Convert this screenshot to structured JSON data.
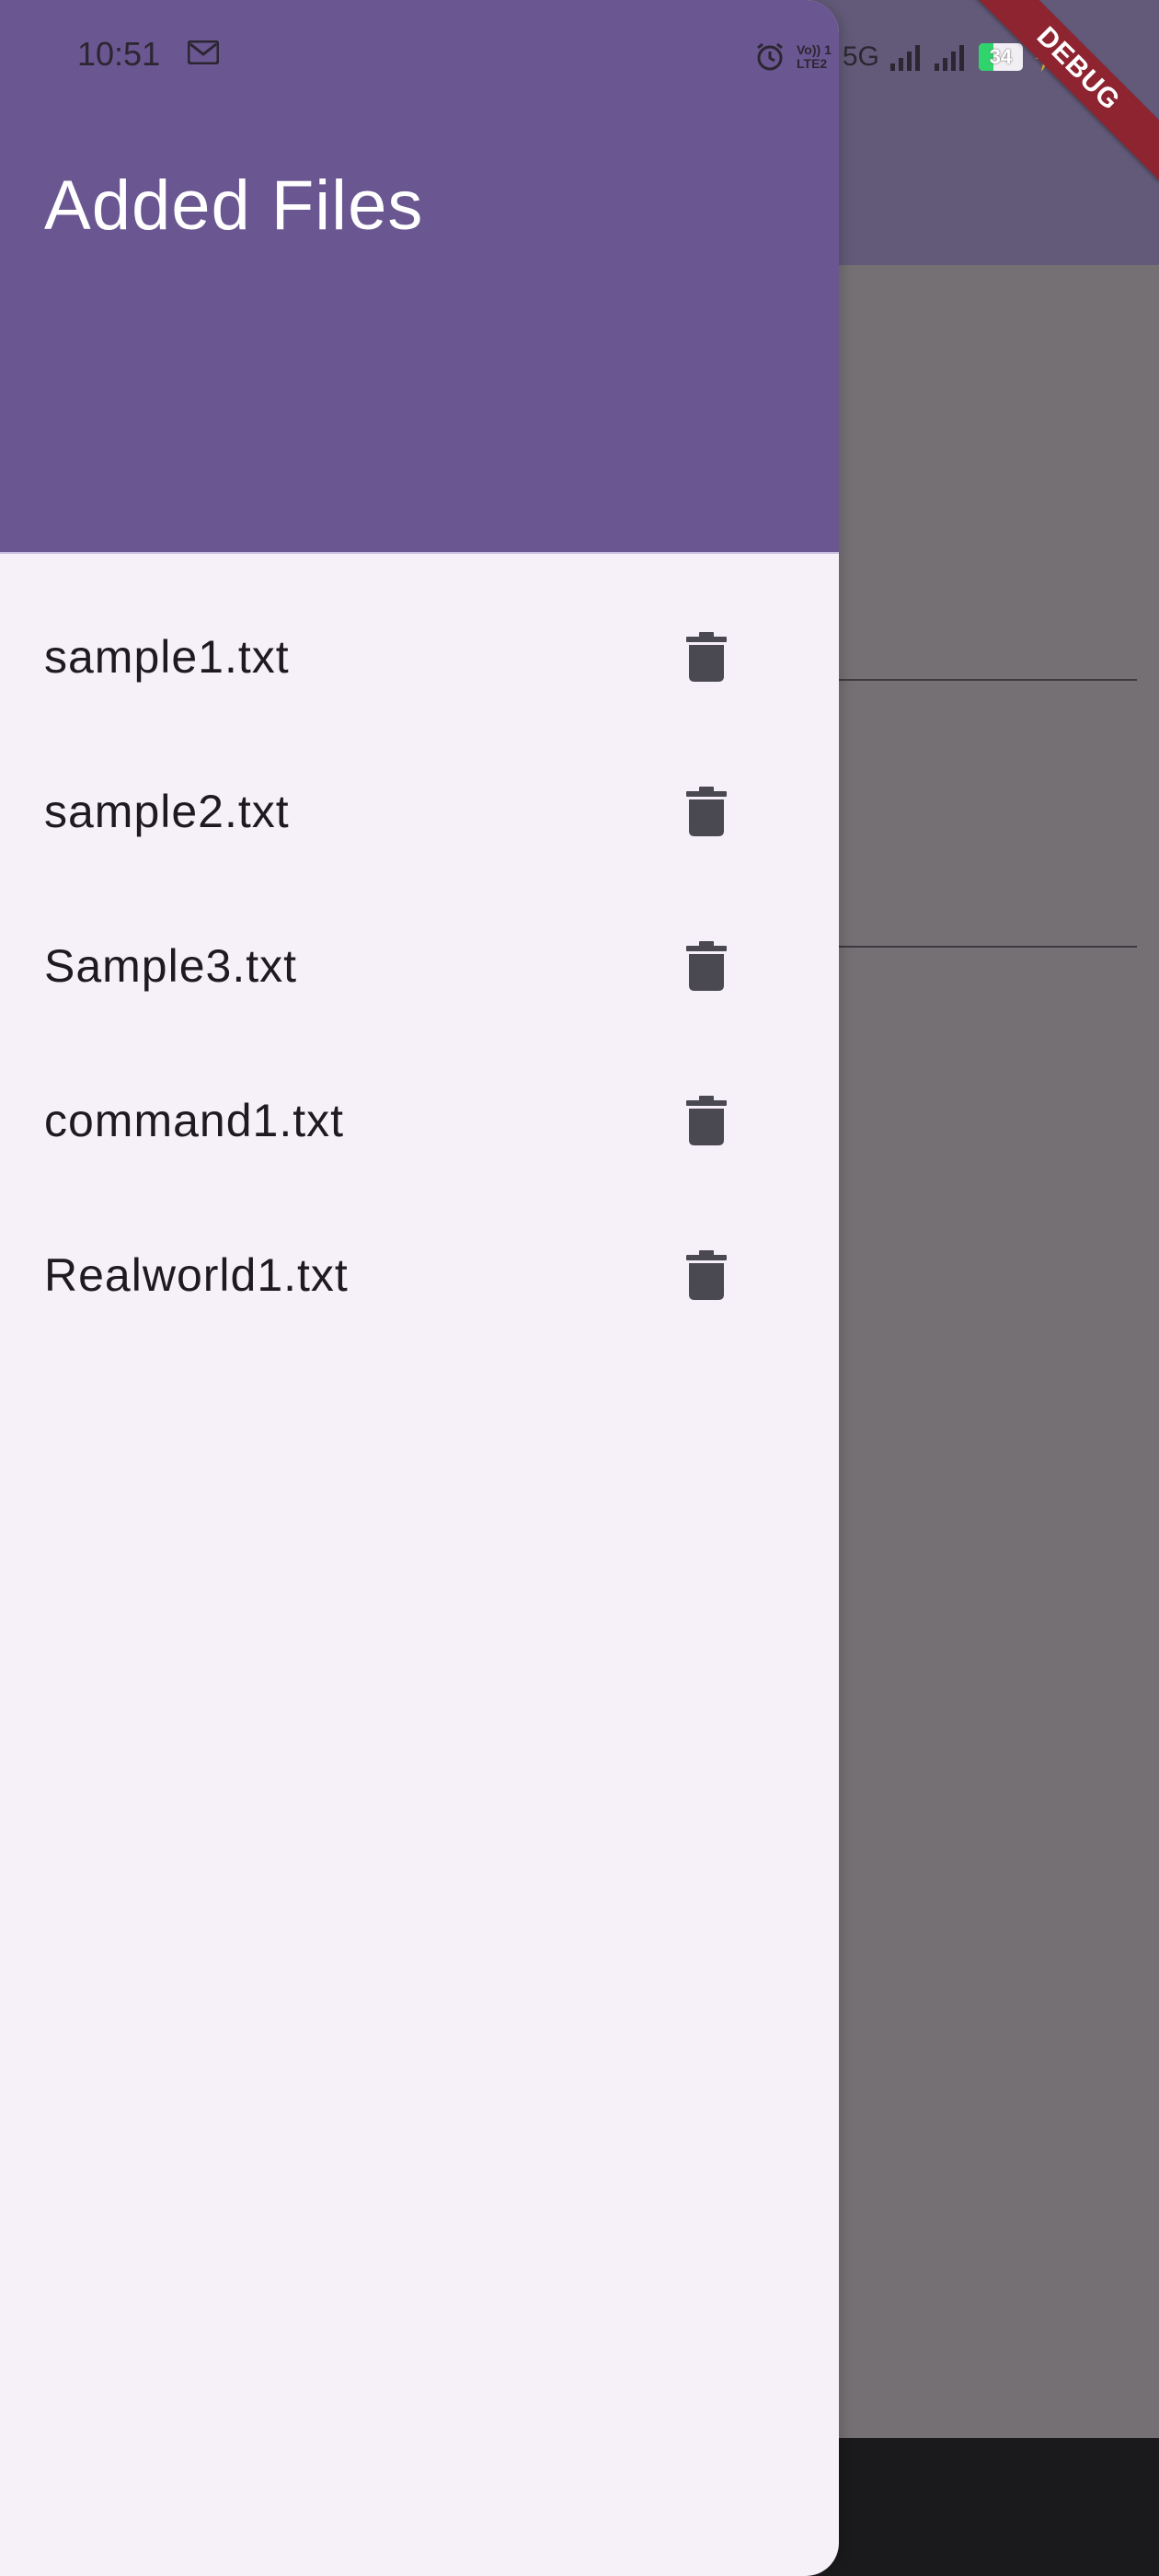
{
  "status_bar": {
    "time": "10:51",
    "network": "5G",
    "volte_line1": "Vo)) 1",
    "volte_line2": "LTE2",
    "battery": "34"
  },
  "debug_banner": "DEBUG",
  "drawer": {
    "title": "Added Files",
    "files": [
      {
        "name": "sample1.txt"
      },
      {
        "name": "sample2.txt"
      },
      {
        "name": "Sample3.txt"
      },
      {
        "name": "command1.txt"
      },
      {
        "name": "Realworld1.txt"
      }
    ],
    "delete_icon": "delete-icon"
  },
  "colors": {
    "header": "#6a5690",
    "drawer_bg": "#f6f0f8",
    "scrim": "#747074",
    "icon": "#4a4850"
  }
}
